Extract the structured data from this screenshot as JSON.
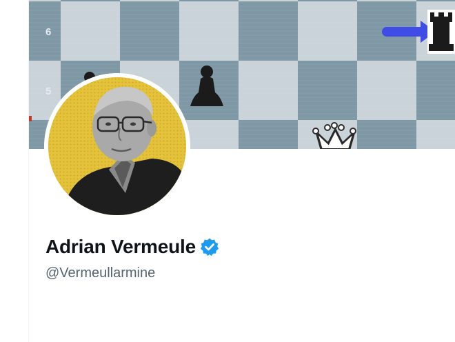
{
  "banner": {
    "description_icon": "chessboard-banner",
    "rank_labels": [
      "6",
      "5"
    ],
    "colors": {
      "light_square": "#c9d3d8",
      "dark_square": "#7f98a5",
      "arrow": "#3f4ce6"
    }
  },
  "avatar": {
    "icon": "profile-photo",
    "background_color": "#e4c23a"
  },
  "profile": {
    "display_name": "Adrian Vermeule",
    "handle": "@Vermeullarmine",
    "verified": true,
    "verified_color": "#1d9bf0"
  }
}
